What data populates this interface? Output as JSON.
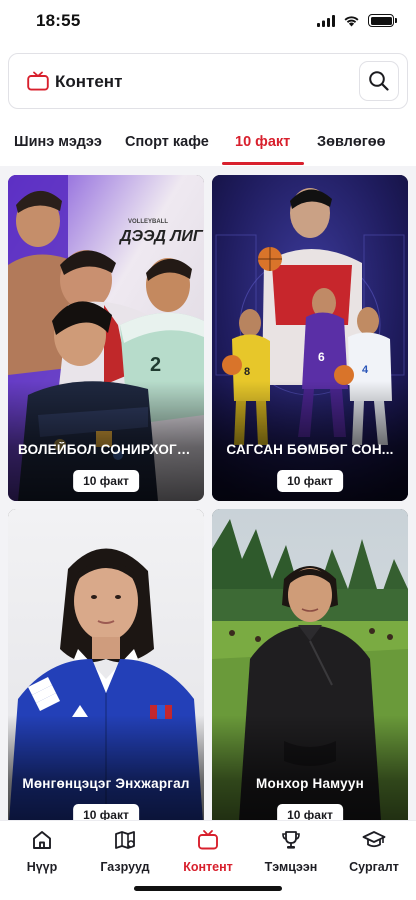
{
  "status": {
    "time": "18:55"
  },
  "header": {
    "title": "Контент",
    "icon": "tv-icon",
    "search_icon": "search-icon"
  },
  "tabs": [
    {
      "label": "Шинэ мэдээ",
      "active": false
    },
    {
      "label": "Спорт кафе",
      "active": false
    },
    {
      "label": "10 факт",
      "active": true
    },
    {
      "label": "Зөвлөгөө",
      "active": false
    }
  ],
  "cards": [
    {
      "title": "ВОЛЕЙБОЛ СОНИРХОГЧ...",
      "badge": "10 факт",
      "poster_text": "ДЭЭД ЛИГ",
      "poster_small": "VOLLEYBALL"
    },
    {
      "title": "САГСАН БӨМБӨГ СОН...",
      "badge": "10 факт"
    },
    {
      "title": "Мөнгөнцэцэг Энхжаргал",
      "badge": "10 факт"
    },
    {
      "title": "Монхор Намуун",
      "badge": "10 факт"
    }
  ],
  "nav": [
    {
      "label": "Нүүр",
      "icon": "home-icon",
      "active": false
    },
    {
      "label": "Газрууд",
      "icon": "map-icon",
      "active": false
    },
    {
      "label": "Контент",
      "icon": "tv-icon",
      "active": true
    },
    {
      "label": "Тэмцээн",
      "icon": "trophy-icon",
      "active": false
    },
    {
      "label": "Сургалт",
      "icon": "graduation-cap-icon",
      "active": false
    }
  ],
  "colors": {
    "accent": "#d8202d",
    "text": "#1e1e24",
    "background": "#ffffff",
    "content_bg": "#f3f3f6"
  }
}
